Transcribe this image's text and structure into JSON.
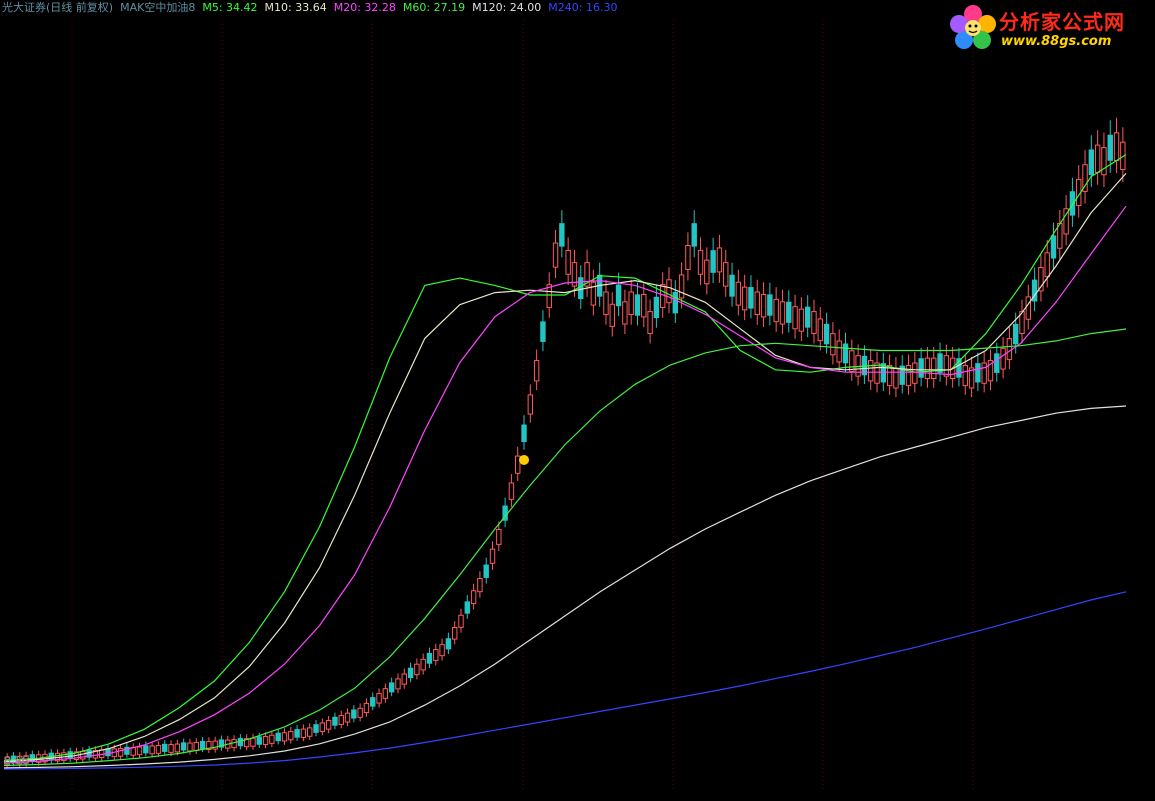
{
  "header": {
    "broker": "光大证券(日线 前复权)",
    "indicator": "MAK空中加油8"
  },
  "legend": [
    {
      "label": "M5: 34.42",
      "color": "#33ff33"
    },
    {
      "label": "M10: 33.64",
      "color": "#e6e6c8"
    },
    {
      "label": "M20: 32.28",
      "color": "#ff44ff"
    },
    {
      "label": "M60: 27.19",
      "color": "#44ee44"
    },
    {
      "label": "M120: 24.00",
      "color": "#e0e0e0"
    },
    {
      "label": "M240: 16.30",
      "color": "#3344ff"
    }
  ],
  "logo": {
    "name": "分析家公式网",
    "url": "www.88gs.com",
    "icon": "flower-logo-icon"
  },
  "price_axis_label": "8.96",
  "colors": {
    "background": "#000000",
    "up_candle": "#ff5a5a",
    "down_candle": "#22c4c4",
    "grid": "#5a0000",
    "signal_marker": "#ffcc00"
  },
  "chart_data": {
    "type": "candlestick",
    "y_scale": "linear",
    "ylim": [
      8.0,
      40.0
    ],
    "n_bars": 248,
    "grid": "vertical dotted",
    "candles_close": [
      9.3,
      9.32,
      9.34,
      9.36,
      9.38,
      9.4,
      9.42,
      9.44,
      9.46,
      9.48,
      9.5,
      9.52,
      9.54,
      9.56,
      9.58,
      9.6,
      9.62,
      9.64,
      9.66,
      9.68,
      9.7,
      9.72,
      9.74,
      9.76,
      9.78,
      9.8,
      9.82,
      9.84,
      9.86,
      9.88,
      9.9,
      9.92,
      9.94,
      9.96,
      9.98,
      10.0,
      10.02,
      10.04,
      10.06,
      10.08,
      10.1,
      10.15,
      10.2,
      10.25,
      10.3,
      10.35,
      10.4,
      10.45,
      10.5,
      10.6,
      10.7,
      10.8,
      10.9,
      11.0,
      11.1,
      11.2,
      11.3,
      11.5,
      11.7,
      11.9,
      12.1,
      12.3,
      12.5,
      12.7,
      12.9,
      13.1,
      13.3,
      13.5,
      13.7,
      13.9,
      14.1,
      14.6,
      15.1,
      15.6,
      16.1,
      16.6,
      17.1,
      17.8,
      18.6,
      19.5,
      20.5,
      21.6,
      22.8,
      24.1,
      25.5,
      27.0,
      28.6,
      30.3,
      31.0,
      30.0,
      29.5,
      28.8,
      29.5,
      28.7,
      28.9,
      28.3,
      27.8,
      28.5,
      27.9,
      28.3,
      28.1,
      28.2,
      27.5,
      28.0,
      28.6,
      28.8,
      28.2,
      29.0,
      30.2,
      31.0,
      30.0,
      29.6,
      29.9,
      30.1,
      29.5,
      28.9,
      28.7,
      28.5,
      28.4,
      28.3,
      28.2,
      28.1,
      28.0,
      27.9,
      27.8,
      27.7,
      27.6,
      27.6,
      27.5,
      27.2,
      26.9,
      26.6,
      26.3,
      26.1,
      25.9,
      25.7,
      25.6,
      25.5,
      25.4,
      25.3,
      25.3,
      25.2,
      25.2,
      25.3,
      25.4,
      25.5,
      25.6,
      25.6,
      25.7,
      25.7,
      25.6,
      25.5,
      25.3,
      25.2,
      25.3,
      25.4,
      25.5,
      25.7,
      26.0,
      26.4,
      26.9,
      27.5,
      28.1,
      28.7,
      29.3,
      29.9,
      30.5,
      31.1,
      31.7,
      32.3,
      32.9,
      33.5,
      34.0,
      34.3,
      34.2,
      34.6,
      34.8,
      34.42
    ],
    "candles_open": [
      9.28,
      9.3,
      9.32,
      9.34,
      9.36,
      9.38,
      9.4,
      9.42,
      9.44,
      9.46,
      9.48,
      9.5,
      9.52,
      9.54,
      9.56,
      9.58,
      9.6,
      9.62,
      9.64,
      9.66,
      9.68,
      9.7,
      9.72,
      9.74,
      9.76,
      9.78,
      9.8,
      9.82,
      9.84,
      9.86,
      9.88,
      9.9,
      9.92,
      9.94,
      9.96,
      9.98,
      10.0,
      10.02,
      10.04,
      10.06,
      10.08,
      10.1,
      10.15,
      10.2,
      10.25,
      10.3,
      10.35,
      10.4,
      10.45,
      10.5,
      10.6,
      10.7,
      10.8,
      10.9,
      11.0,
      11.1,
      11.2,
      11.3,
      11.5,
      11.7,
      11.9,
      12.1,
      12.3,
      12.5,
      12.7,
      12.9,
      13.1,
      13.3,
      13.5,
      13.7,
      13.9,
      14.1,
      14.6,
      15.1,
      15.6,
      16.1,
      16.6,
      17.1,
      17.8,
      18.6,
      19.5,
      20.5,
      21.6,
      22.8,
      24.1,
      25.5,
      27.0,
      28.6,
      30.3,
      31.0,
      30.0,
      29.5,
      28.8,
      29.5,
      28.7,
      28.9,
      28.3,
      27.8,
      28.5,
      27.9,
      28.3,
      28.1,
      28.2,
      27.5,
      28.0,
      28.6,
      28.8,
      28.2,
      29.0,
      30.2,
      31.0,
      30.0,
      29.6,
      29.9,
      30.1,
      29.5,
      28.9,
      28.7,
      28.5,
      28.4,
      28.3,
      28.2,
      28.1,
      28.0,
      27.9,
      27.8,
      27.7,
      27.6,
      27.6,
      27.5,
      27.2,
      26.9,
      26.6,
      26.3,
      26.1,
      25.9,
      25.7,
      25.6,
      25.5,
      25.4,
      25.3,
      25.3,
      25.2,
      25.2,
      25.3,
      25.4,
      25.5,
      25.6,
      25.6,
      25.7,
      25.7,
      25.6,
      25.5,
      25.3,
      25.2,
      25.3,
      25.4,
      25.5,
      25.7,
      26.0,
      26.4,
      26.9,
      27.5,
      28.1,
      28.7,
      29.3,
      29.9,
      30.5,
      31.1,
      31.7,
      32.3,
      32.9,
      33.5,
      34.0,
      34.3,
      34.2,
      34.6,
      34.8
    ],
    "series": [
      {
        "name": "M5",
        "values": [
          9.3,
          9.4,
          9.6,
          10.0,
          10.6,
          11.5,
          12.6,
          14.2,
          16.3,
          19.0,
          22.3,
          26.0,
          29.0,
          29.3,
          29.0,
          28.6,
          28.6,
          29.4,
          29.3,
          28.6,
          27.9,
          26.3,
          25.5,
          25.4,
          25.6,
          25.7,
          25.4,
          25.5,
          27.0,
          29.0,
          31.3,
          33.5,
          34.42
        ]
      },
      {
        "name": "M10",
        "values": [
          9.25,
          9.35,
          9.5,
          9.8,
          10.3,
          11.0,
          11.9,
          13.2,
          15.0,
          17.3,
          20.3,
          23.7,
          26.8,
          28.2,
          28.7,
          28.8,
          28.7,
          29.0,
          29.2,
          28.9,
          28.3,
          27.2,
          26.1,
          25.6,
          25.5,
          25.6,
          25.5,
          25.5,
          26.3,
          27.8,
          29.8,
          32.0,
          33.64
        ]
      },
      {
        "name": "M20",
        "values": [
          9.2,
          9.28,
          9.4,
          9.6,
          9.95,
          10.5,
          11.2,
          12.1,
          13.3,
          14.9,
          17.0,
          19.8,
          23.0,
          25.8,
          27.7,
          28.7,
          29.1,
          29.2,
          29.0,
          28.5,
          27.8,
          26.9,
          26.0,
          25.6,
          25.4,
          25.4,
          25.4,
          25.3,
          25.6,
          26.6,
          28.3,
          30.3,
          32.28
        ]
      },
      {
        "name": "M60",
        "values": [
          9.1,
          9.14,
          9.2,
          9.3,
          9.42,
          9.6,
          9.85,
          10.2,
          10.7,
          11.4,
          12.3,
          13.6,
          15.2,
          17.0,
          18.9,
          20.7,
          22.4,
          23.8,
          24.9,
          25.7,
          26.2,
          26.5,
          26.6,
          26.5,
          26.4,
          26.3,
          26.3,
          26.3,
          26.4,
          26.5,
          26.7,
          27.0,
          27.19
        ]
      },
      {
        "name": "M120",
        "values": [
          9.0,
          9.02,
          9.05,
          9.1,
          9.16,
          9.24,
          9.35,
          9.5,
          9.7,
          10.0,
          10.4,
          10.9,
          11.6,
          12.4,
          13.3,
          14.3,
          15.3,
          16.3,
          17.2,
          18.1,
          18.9,
          19.6,
          20.3,
          20.9,
          21.4,
          21.9,
          22.3,
          22.7,
          23.1,
          23.4,
          23.7,
          23.9,
          24.0
        ]
      },
      {
        "name": "M240",
        "values": [
          8.95,
          8.96,
          8.98,
          9.0,
          9.03,
          9.07,
          9.12,
          9.2,
          9.3,
          9.45,
          9.62,
          9.82,
          10.05,
          10.3,
          10.56,
          10.82,
          11.08,
          11.34,
          11.6,
          11.86,
          12.12,
          12.4,
          12.7,
          13.0,
          13.32,
          13.66,
          14.0,
          14.38,
          14.76,
          15.16,
          15.56,
          15.96,
          16.3
        ]
      }
    ]
  }
}
